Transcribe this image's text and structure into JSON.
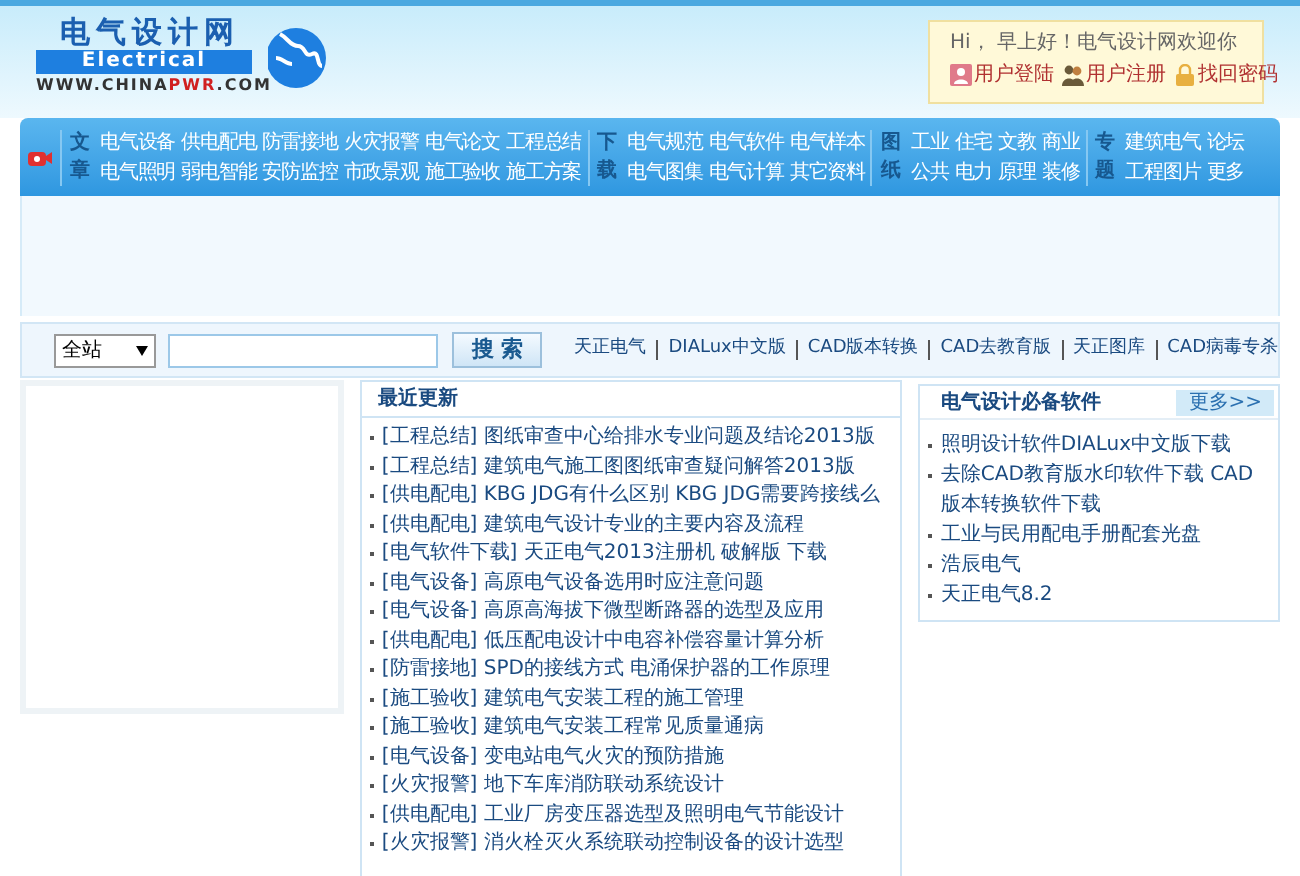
{
  "logo": {
    "title": "电气设计网",
    "subtitle": "Electrical",
    "url_prefix": "WWW.CHINA",
    "url_highlight": "PWR",
    "url_suffix": ".COM"
  },
  "welcome": {
    "greeting": "Hi， 早上好！电气设计网欢迎你",
    "links": [
      {
        "kind": "login",
        "label": "用户登陆"
      },
      {
        "kind": "register",
        "label": "用户注册"
      },
      {
        "kind": "password",
        "label": "找回密码"
      }
    ]
  },
  "nav_groups": [
    {
      "label": "文章",
      "rows": [
        [
          "电气设备",
          "供电配电",
          "防雷接地",
          "火灾报警",
          "电气论文",
          "工程总结"
        ],
        [
          "电气照明",
          "弱电智能",
          "安防监控",
          "市政景观",
          "施工验收",
          "施工方案"
        ]
      ]
    },
    {
      "label": "下载",
      "rows": [
        [
          "电气规范",
          "电气软件",
          "电气样本"
        ],
        [
          "电气图集",
          "电气计算",
          "其它资料"
        ]
      ]
    },
    {
      "label": "图纸",
      "rows": [
        [
          "工业",
          "住宅",
          "文教",
          "商业"
        ],
        [
          "公共",
          "电力",
          "原理",
          "装修"
        ]
      ]
    },
    {
      "label": "专题",
      "rows": [
        [
          "建筑电气",
          "论坛"
        ],
        [
          "工程图片",
          "更多"
        ]
      ]
    }
  ],
  "search": {
    "scope": "全站",
    "button": "搜 索",
    "links": [
      "天正电气",
      "DIALux中文版",
      "CAD版本转换",
      "CAD去教育版",
      "天正图库",
      "CAD病毒专杀"
    ]
  },
  "recent": {
    "title": "最近更新",
    "items": [
      "[工程总结] 图纸审查中心给排水专业问题及结论2013版",
      "[工程总结] 建筑电气施工图图纸审查疑问解答2013版",
      "[供电配电] KBG JDG有什么区别 KBG JDG需要跨接线么",
      "[供电配电] 建筑电气设计专业的主要内容及流程",
      "[电气软件下载] 天正电气2013注册机 破解版 下载",
      "[电气设备] 高原电气设备选用时应注意问题",
      "[电气设备] 高原高海拔下微型断路器的选型及应用",
      "[供电配电] 低压配电设计中电容补偿容量计算分析",
      "[防雷接地] SPD的接线方式 电涌保护器的工作原理",
      "[施工验收] 建筑电气安装工程的施工管理",
      "[施工验收] 建筑电气安装工程常见质量通病",
      "[电气设备] 变电站电气火灾的预防措施",
      "[火灾报警] 地下车库消防联动系统设计",
      "[供电配电] 工业厂房变压器选型及照明电气节能设计",
      "[火灾报警] 消火栓灭火系统联动控制设备的设计选型"
    ]
  },
  "software": {
    "title": "电气设计必备软件",
    "more": "更多>>",
    "items": [
      "照明设计软件DIALux中文版下载",
      "去除CAD教育版水印软件下载 CAD版本转换软件下载",
      "工业与民用配电手册配套光盘",
      "浩辰电气",
      "天正电气8.2"
    ]
  }
}
